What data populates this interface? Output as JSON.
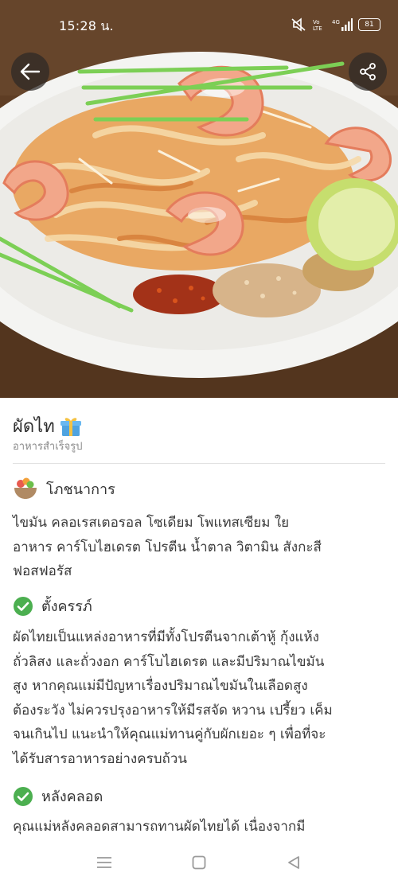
{
  "status_bar": {
    "time": "15:28 น.",
    "battery": "81",
    "icons": [
      "mute-icon",
      "volte-icon",
      "4g-signal-icon",
      "battery-icon"
    ]
  },
  "hero": {
    "image": "pad-thai-with-shrimp-photo"
  },
  "dish": {
    "title": "ผัดไท",
    "title_icon": "gift-icon",
    "category": "อาหารสำเร็จรูป"
  },
  "sections": [
    {
      "icon": "food-bowl-icon",
      "title": "โภชนาการ",
      "lines": [
        "ไขมัน คลอเรสเตอรอล โซเดียม โพแทสเซียม ใย",
        "อาหาร คาร์โบไฮเดรต โปรตีน น้ำตาล วิตามิน สังกะสี",
        "ฟอสฟอรัส"
      ]
    },
    {
      "icon": "check-circle-icon",
      "title": "ตั้งครรภ์",
      "lines": [
        "ผัดไทยเป็นแหล่งอาหารที่มีทั้งโปรตีนจากเต้าหู้ กุ้งแห้ง",
        "ถั่วลิสง และถั่วงอก คาร์โบไฮเดรต และมีปริมาณไขมัน",
        "สูง หากคุณแม่มีปัญหาเรื่องปริมาณไขมันในเลือดสูง",
        "ต้องระวัง ไม่ควรปรุงอาหารให้มีรสจัด หวาน เปรี้ยว เค็ม",
        "จนเกินไป แนะนำให้คุณแม่ทานคู่กับผักเยอะ ๆ เพื่อที่จะ",
        "ได้รับสารอาหารอย่างครบถ้วน"
      ]
    },
    {
      "icon": "check-circle-icon",
      "title": "หลังคลอด",
      "lines": [
        "คุณแม่หลังคลอดสามารถทานผัดไทยได้ เนื่องจากมี"
      ]
    }
  ],
  "colors": {
    "check_green": "#4caf50",
    "divider": "#e2e2e2",
    "text": "#3a3a3a",
    "subtitle": "#8a8a8a"
  },
  "nav_bar": {
    "buttons": [
      "menu-icon",
      "home-square-icon",
      "back-triangle-icon"
    ]
  }
}
